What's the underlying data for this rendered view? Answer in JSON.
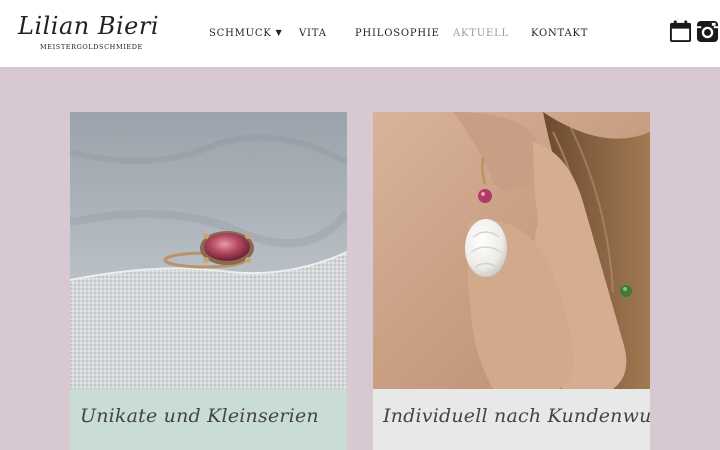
{
  "brand": {
    "name": "Lilian Bieri",
    "tagline": "MEISTERGOLDSCHMIEDE"
  },
  "nav": {
    "items": [
      {
        "label": "SCHMUCK",
        "has_dropdown": true,
        "active": false
      },
      {
        "label": "VITA",
        "has_dropdown": false,
        "active": false
      },
      {
        "label": "PHILOSOPHIE",
        "has_dropdown": false,
        "active": false
      },
      {
        "label": "AKTUELL",
        "has_dropdown": false,
        "active": true
      },
      {
        "label": "KONTAKT",
        "has_dropdown": false,
        "active": false
      }
    ]
  },
  "social": {
    "icons": [
      "calendar-icon",
      "instagram-icon"
    ]
  },
  "cards": [
    {
      "caption": "Unikate und Kleinserien",
      "image": "ring-photo",
      "caption_color": "#c9ddd6"
    },
    {
      "caption": "Individuell nach Kundenwunsch",
      "image": "earring-photo",
      "caption_color": "#e8e8e8"
    }
  ],
  "colors": {
    "page_background": "#d8c8d2",
    "header_background": "#ffffff",
    "nav_active": "#9a9a9a",
    "text": "#222222"
  }
}
